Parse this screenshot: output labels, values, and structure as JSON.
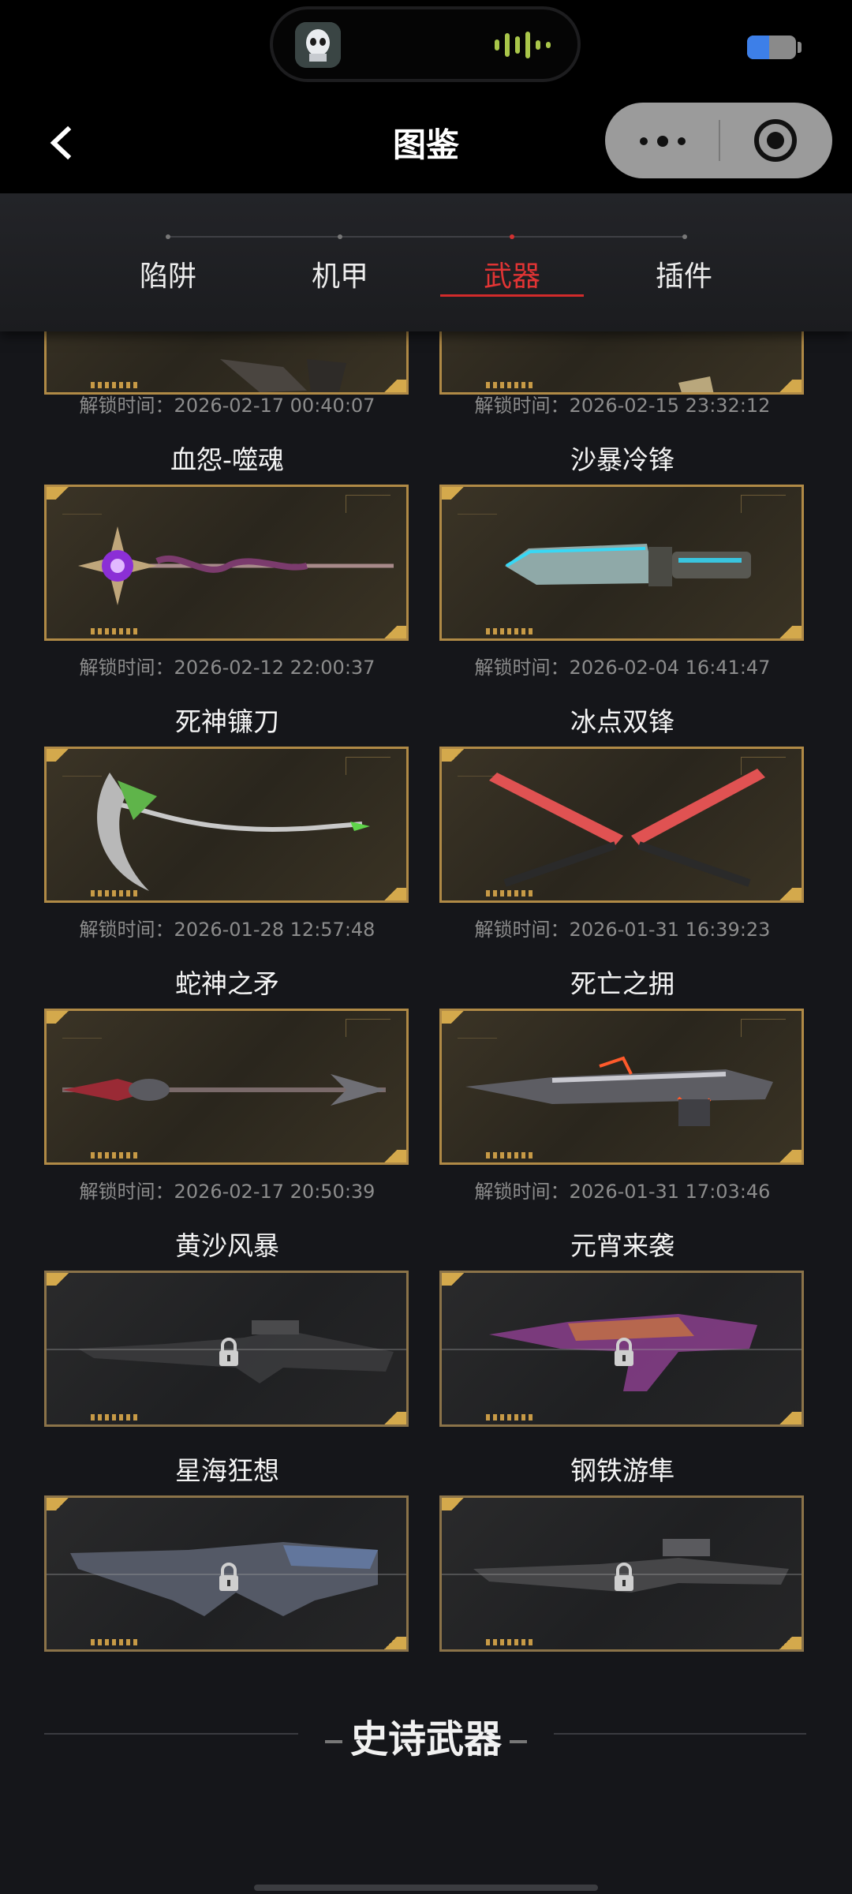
{
  "status_bar": {
    "battery_level": 0.45,
    "battery_color": "#3d7fe8"
  },
  "navbar": {
    "title": "图鉴",
    "back_icon": "chevron-left-icon",
    "more_icon": "three-dots-icon",
    "close_icon": "target-circle-icon"
  },
  "tabs": [
    {
      "label": "陷阱",
      "active": false
    },
    {
      "label": "机甲",
      "active": false
    },
    {
      "label": "武器",
      "active": true
    },
    {
      "label": "插件",
      "active": false
    }
  ],
  "colors": {
    "active_tab": "#e03434",
    "card_border": "#b08a46",
    "unlock_text": "#8c8c8c"
  },
  "top_partial": [
    {
      "unlock_label": "解锁时间：2026-02-17 00:40:07"
    },
    {
      "unlock_label": "解锁时间：2026-02-15 23:32:12"
    }
  ],
  "weapons": [
    {
      "name": "血怨-噬魂",
      "unlock_label": "解锁时间：2026-02-12 22:00:37",
      "locked": false
    },
    {
      "name": "沙暴冷锋",
      "unlock_label": "解锁时间：2026-02-04 16:41:47",
      "locked": false
    },
    {
      "name": "死神镰刀",
      "unlock_label": "解锁时间：2026-01-28 12:57:48",
      "locked": false
    },
    {
      "name": "冰点双锋",
      "unlock_label": "解锁时间：2026-01-31 16:39:23",
      "locked": false
    },
    {
      "name": "蛇神之矛",
      "unlock_label": "解锁时间：2026-02-17 20:50:39",
      "locked": false
    },
    {
      "name": "死亡之拥",
      "unlock_label": "解锁时间：2026-01-31 17:03:46",
      "locked": false
    },
    {
      "name": "黄沙风暴",
      "locked": true
    },
    {
      "name": "元宵来袭",
      "locked": true
    },
    {
      "name": "星海狂想",
      "locked": true
    },
    {
      "name": "钢铁游隼",
      "locked": true
    }
  ],
  "section": {
    "title": "史诗武器"
  }
}
